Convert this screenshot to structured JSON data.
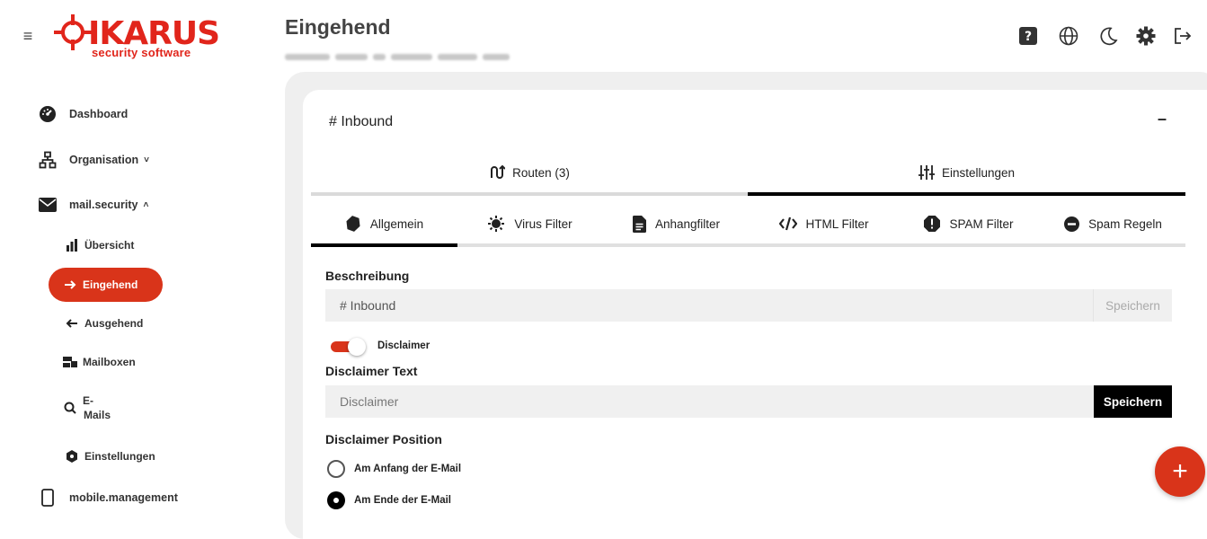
{
  "brand": {
    "name": "IKARUS",
    "tagline": "security software",
    "color": "#e1251b"
  },
  "sidebar": {
    "items": [
      {
        "label": "Dashboard",
        "icon": "dashboard-gauge-icon"
      },
      {
        "label": "Organisation",
        "icon": "sitemap-icon",
        "caret": "˅"
      },
      {
        "label": "mail.security",
        "icon": "envelope-icon",
        "caret": "˄"
      },
      {
        "label": "mobile.management",
        "icon": "mobile-icon"
      }
    ],
    "sub_items": [
      {
        "label": "Übersicht",
        "icon": "bar-chart-icon"
      },
      {
        "label": "Eingehend",
        "icon": "arrow-right-icon",
        "active": true
      },
      {
        "label": "Ausgehend",
        "icon": "arrow-left-icon"
      },
      {
        "label": "Mailboxen",
        "icon": "mailboxes-icon"
      },
      {
        "label_line1": "E-",
        "label_line2": "Mails",
        "icon": "search-icon"
      },
      {
        "label": "Einstellungen",
        "icon": "settings-hex-icon"
      }
    ]
  },
  "header": {
    "title": "Eingehend",
    "icons": [
      "help-icon",
      "globe-icon",
      "moon-icon",
      "gear-icon",
      "logout-icon"
    ]
  },
  "card": {
    "title": "# Inbound",
    "collapse_label": "–",
    "main_tabs": [
      {
        "label": "Routen (3)",
        "icon": "route-icon",
        "active": false
      },
      {
        "label": "Einstellungen",
        "icon": "sliders-icon",
        "active": true
      }
    ],
    "sub_tabs": [
      {
        "label": "Allgemein",
        "icon": "diamond-icon",
        "active": true
      },
      {
        "label": "Virus Filter",
        "icon": "virus-icon",
        "active": false
      },
      {
        "label": "Anhangfilter",
        "icon": "file-icon",
        "active": false
      },
      {
        "label": "HTML Filter",
        "icon": "code-icon",
        "active": false
      },
      {
        "label": "SPAM Filter",
        "icon": "spam-octagon-icon",
        "active": false
      },
      {
        "label": "Spam Regeln",
        "icon": "minus-circle-icon",
        "active": false
      }
    ]
  },
  "form": {
    "description_label": "Beschreibung",
    "description_value": "# Inbound",
    "save_label": "Speichern",
    "disclaimer_toggle_label": "Disclaimer",
    "disclaimer_enabled": true,
    "disclaimer_text_label": "Disclaimer Text",
    "disclaimer_placeholder": "Disclaimer",
    "position_label": "Disclaimer Position",
    "position_options": [
      {
        "label": "Am Anfang der E-Mail",
        "selected": false
      },
      {
        "label": "Am Ende der E-Mail",
        "selected": true
      }
    ]
  },
  "fab_label": "+",
  "colors": {
    "accent": "#d9341a",
    "active_tab": "#000000",
    "panel": "#efefef"
  }
}
